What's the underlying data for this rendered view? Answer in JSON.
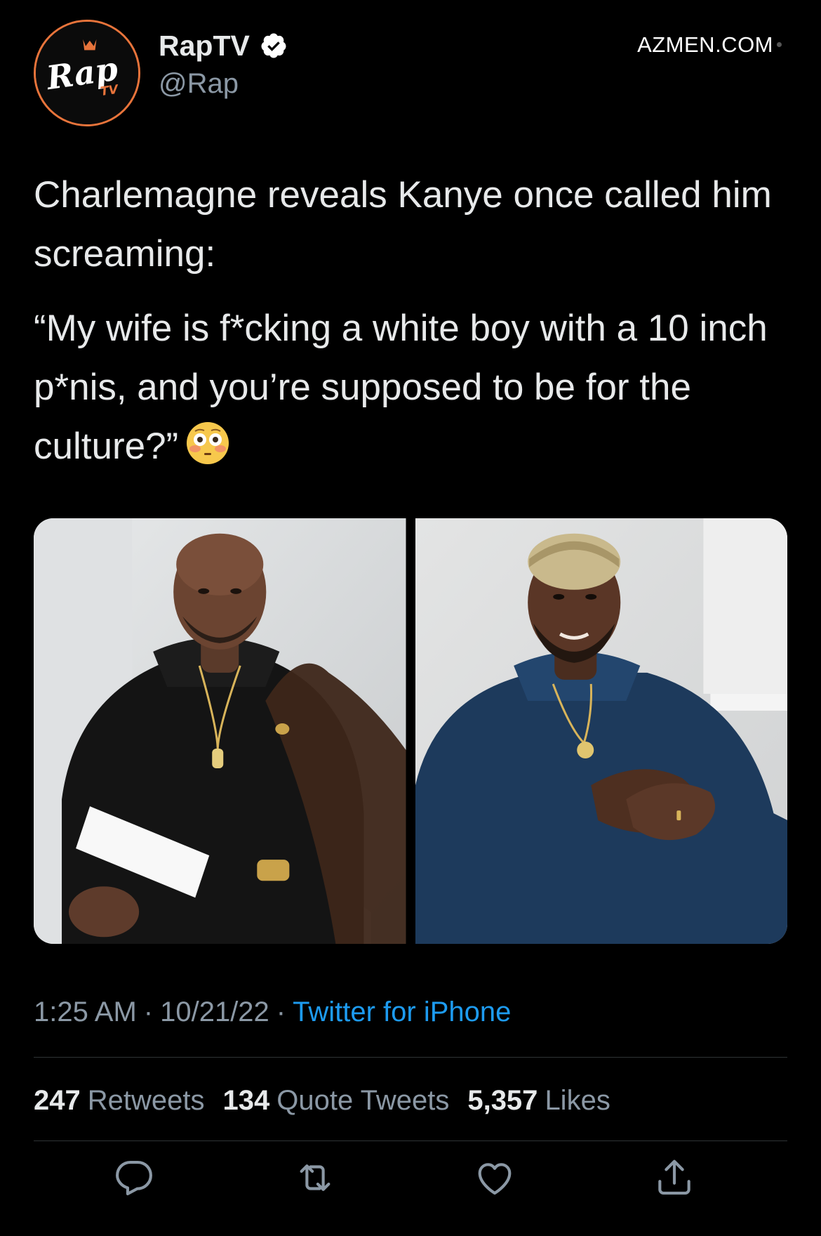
{
  "account": {
    "display_name": "RapTV",
    "handle": "@Rap",
    "verified": true,
    "avatar_logo_text": "Rap",
    "avatar_logo_sub": "TV"
  },
  "watermark": "AZMEN.COM",
  "tweet": {
    "paragraph_1": "Charlemagne reveals Kanye once called him screaming:",
    "paragraph_2": "“My wife is f*cking a white boy with a 10 inch p*nis, and you’re supposed to be for the culture?”",
    "emoji": "flushed-face"
  },
  "media": {
    "count": 2
  },
  "meta": {
    "time": "1:25 AM",
    "date": "10/21/22",
    "source": "Twitter for iPhone",
    "separator": "·"
  },
  "stats": {
    "retweets_count": "247",
    "retweets_label": "Retweets",
    "quotes_count": "134",
    "quotes_label": "Quote Tweets",
    "likes_count": "5,357",
    "likes_label": "Likes"
  },
  "actions": [
    "reply-icon",
    "retweet-icon",
    "like-icon",
    "share-icon"
  ],
  "colors": {
    "background": "#000000",
    "text": "#e7e9ea",
    "muted": "#8b98a5",
    "link": "#1d9bf0",
    "verified_badge": "#ffffff",
    "divider": "#2f3336",
    "avatar_ring": "#e8743b"
  }
}
